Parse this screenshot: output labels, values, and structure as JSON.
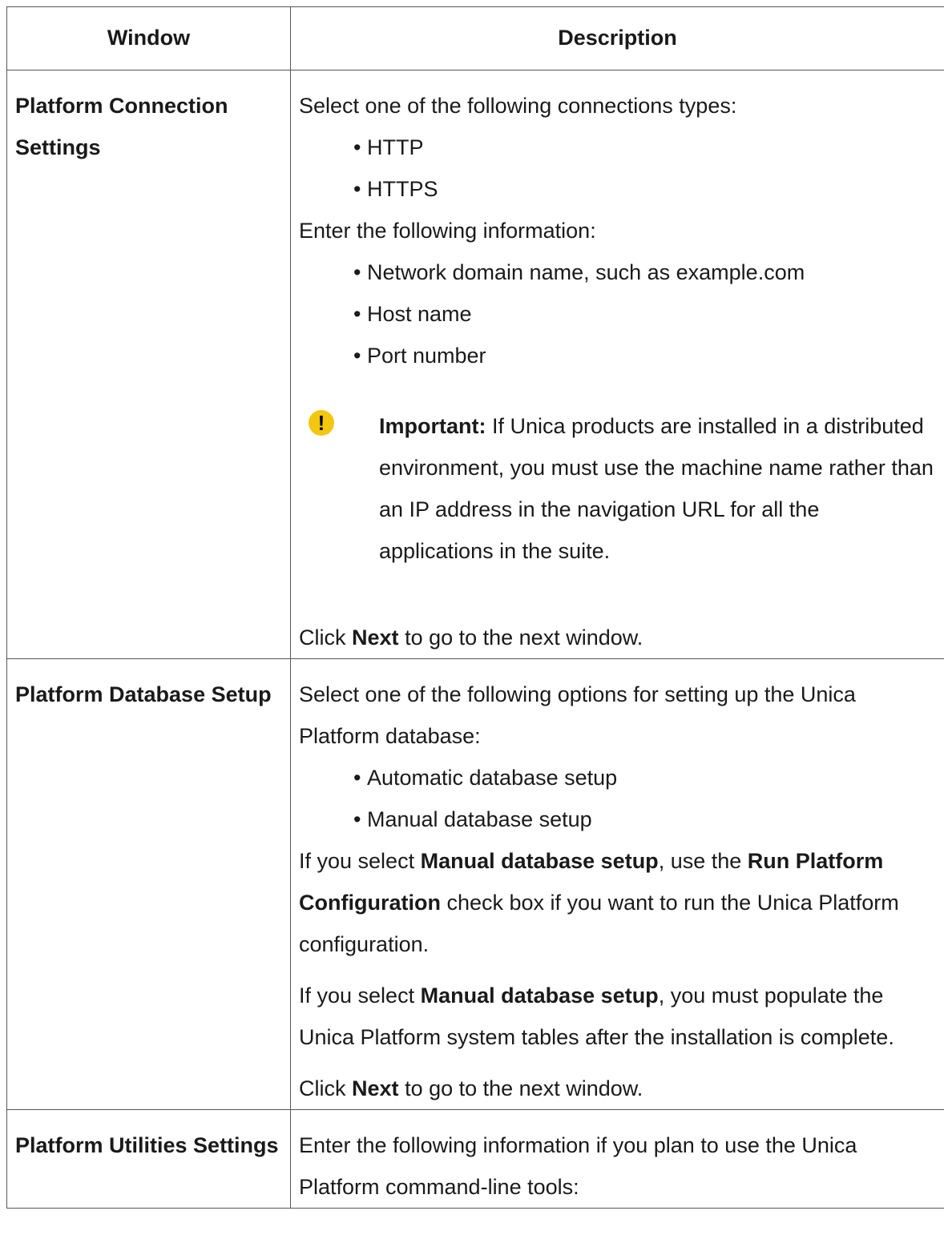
{
  "header": {
    "window": "Window",
    "description": "Description"
  },
  "row1": {
    "window": "Platform Connection Settings",
    "intro": "Select one of the following connections types:",
    "conn_types": [
      "HTTP",
      "HTTPS"
    ],
    "enter": "Enter the following information:",
    "info_items": [
      "Network domain name, such as example.com",
      "Host name",
      "Port number"
    ],
    "note_label": "Important:",
    "note_text": "If Unica products are installed in a distributed environment, you must use the machine name rather than an IP address in the navigation URL for all the applications in the suite.",
    "click_prefix": "Click",
    "click_bold": "Next",
    "click_suffix": "to go to the next window."
  },
  "row2": {
    "window": "Platform Database Setup",
    "intro": "Select one of the following options for setting up the Unica Platform database:",
    "options": [
      "Automatic database setup",
      "Manual database setup"
    ],
    "p1_prefix": "If you select",
    "p1_bold1": "Manual database setup",
    "p1_mid": ", use the",
    "p1_bold2": "Run Platform Configuration",
    "p1_suffix": "check box if you want to run the Unica Platform configuration.",
    "p2_prefix": "If you select",
    "p2_bold": "Manual database setup",
    "p2_suffix": ", you must populate the Unica Platform system tables after the installation is complete.",
    "click_prefix": "Click",
    "click_bold": "Next",
    "click_suffix": "to go to the next window."
  },
  "row3": {
    "window": "Platform Utilities Settings",
    "intro": "Enter the following information if you plan to use the Unica Platform command-line tools:"
  },
  "colors": {
    "border": "#555555",
    "important_icon": "#f3c60f"
  }
}
